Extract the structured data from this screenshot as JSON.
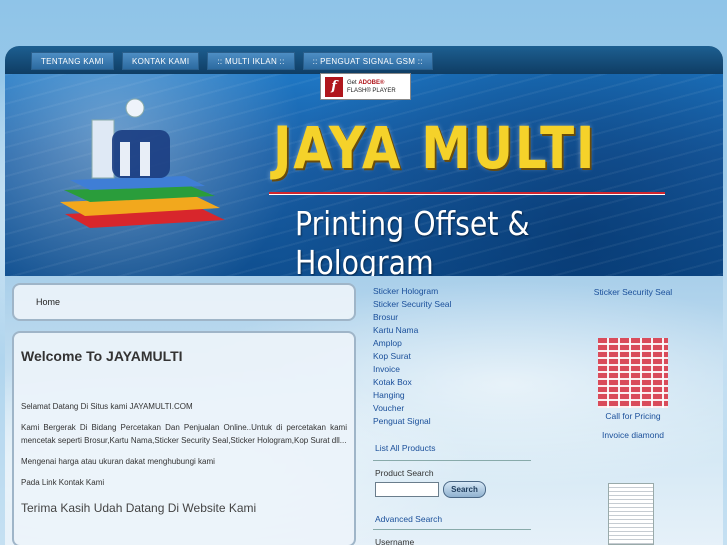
{
  "nav": {
    "items": [
      {
        "label": "TENTANG KAMI"
      },
      {
        "label": "KONTAK KAMI"
      },
      {
        "label": ":: MULTI IKLAN ::"
      },
      {
        "label": ":: PENGUAT SIGNAL GSM ::"
      }
    ]
  },
  "flash": {
    "get": "Get",
    "brand": "ADOBE®",
    "product": "FLASH® PLAYER"
  },
  "banner": {
    "title": "JAYA MULTI",
    "subtitle": "Printing Offset & Hologram"
  },
  "breadcrumb": {
    "home": "Home"
  },
  "main": {
    "heading": "Welcome To JAYAMULTI",
    "p1": "Selamat Datang Di Situs kami JAYAMULTI.COM",
    "p2": "Kami Bergerak Di Bidang Percetakan Dan Penjualan Online..Untuk di percetakan kami mencetak seperti Brosur,Kartu Nama,Sticker Security Seal,Sticker Hologram,Kop Surat dll...",
    "p3": "Mengenai harga atau ukuran dakat menghubungi kami",
    "p4": "Pada Link Kontak Kami",
    "closing": "Terima Kasih Udah Datang Di Website Kami"
  },
  "categories": [
    "Sticker Hologram",
    "Sticker Security Seal",
    "Brosur",
    "Kartu Nama",
    "Amplop",
    "Kop Surat",
    "Invoice",
    "Kotak Box",
    "Hanging",
    "Voucher",
    "Penguat Signal"
  ],
  "sidebar": {
    "list_all": "List All Products",
    "search_label": "Product Search",
    "search_value": "",
    "search_button": "Search",
    "advanced_search": "Advanced Search",
    "username_label": "Username"
  },
  "featured": {
    "title": "Sticker Security Seal",
    "call": "Call for Pricing",
    "next_title": "Invoice diamond"
  }
}
